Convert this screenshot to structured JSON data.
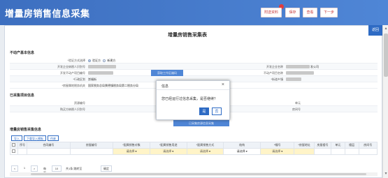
{
  "app": {
    "title": "增量房销售信息采集",
    "buttons": [
      "附送资料",
      "保存",
      "查看",
      "下一步"
    ]
  },
  "page": {
    "title": "增量房销售采集表",
    "exit_label": "返回"
  },
  "sections": {
    "basic": "不动产基本信息",
    "collected": "已采集项目信息",
    "table": "增量房销售采集信息"
  },
  "basic_fields": {
    "verify_type_label": "*验证方式选择",
    "verify_type_options": [
      "验证方",
      "新建方"
    ],
    "dev_taxpayer_id_label": "开发企业纳税人识别号",
    "dev_name_label": "开发企业名称",
    "dev_name_suffix": "发公司",
    "project_number_label": "开发不动产项目编号",
    "project_name_label": "不动产项目名称",
    "district_label": "*行政区划",
    "district_value": "崇福街",
    "street_label": "*街道乡镇",
    "tax_authority_label": "*房屋属地税务机关",
    "tax_authority_value": "国家税务总局景德镇税务局第二税务分局",
    "gdbtn_label": "获取工作区编码"
  },
  "collected_fields": {
    "contract_number_label": "资源编号",
    "unit_label": "单元",
    "buyer_id_label": "购买方纳税人识别号",
    "room_label": "房间号",
    "link_label": "已采集房源信息采集"
  },
  "toolbar": {
    "import_label": "导入",
    "download_label": "下载导入模板",
    "delete_label": "作废"
  },
  "table": {
    "headers": [
      "序号",
      "合同编号",
      "房屋编号",
      "*配属销售对象",
      "*配属销售用途",
      "*配属销售方式",
      "结构",
      "*幢号",
      "*房屋地址",
      "房屋楼号",
      "单元",
      "楼层",
      "房间号"
    ],
    "row": {
      "select_placeholder": "请选择"
    }
  },
  "pager": {
    "first": "<",
    "page": "1",
    "next": ">",
    "goto_label": "每页",
    "page_size": "10",
    "total_text": "共1条 跳转至",
    "go_label": "确定"
  },
  "modal": {
    "title": "信息",
    "message": "您已经运行过信息采集，是否继续？",
    "yes": "是",
    "no": "否"
  },
  "colors": {
    "header_blue": "#3d6fc0",
    "accent": "#2e6bc4",
    "required_yellow": "#fff4c8"
  }
}
